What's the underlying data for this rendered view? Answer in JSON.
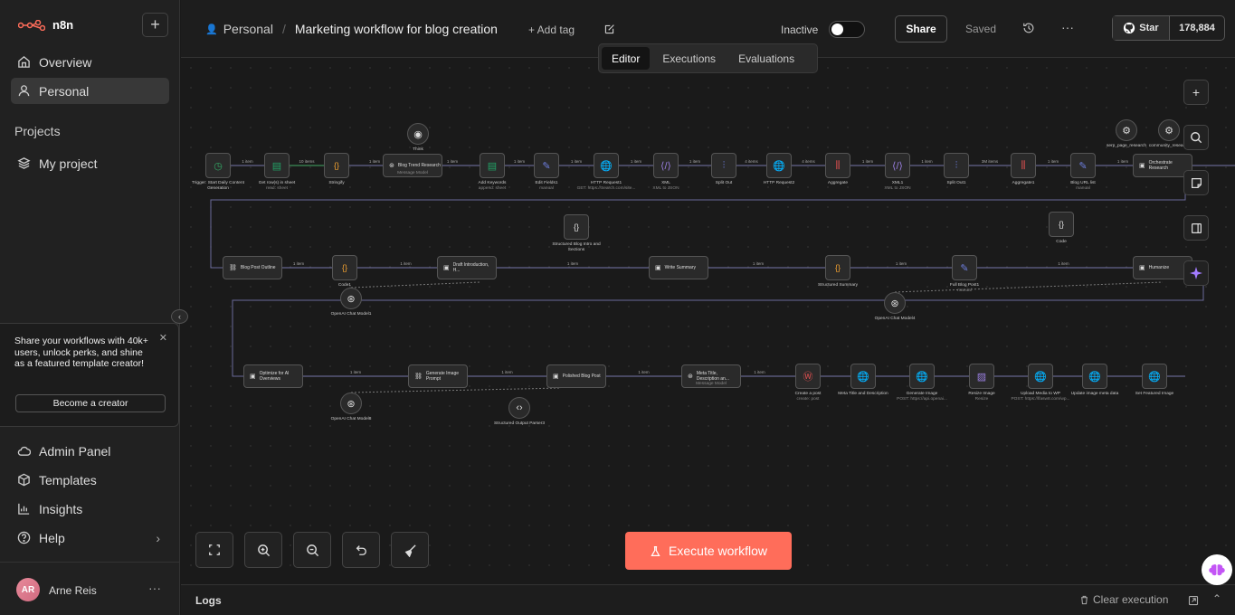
{
  "sidebar": {
    "brand": "n8n",
    "nav": [
      {
        "label": "Overview",
        "icon": "home-icon"
      },
      {
        "label": "Personal",
        "icon": "user-icon"
      }
    ],
    "projects_heading": "Projects",
    "projects": [
      {
        "label": "My project",
        "icon": "layers-icon"
      }
    ],
    "promo": {
      "text": "Share your workflows with 40k+ users, unlock perks, and shine as a featured template creator!",
      "button": "Become a creator"
    },
    "bottom_nav": [
      {
        "label": "Admin Panel",
        "icon": "cloud-icon"
      },
      {
        "label": "Templates",
        "icon": "box-icon"
      },
      {
        "label": "Insights",
        "icon": "chart-icon"
      },
      {
        "label": "Help",
        "icon": "help-icon"
      }
    ],
    "user": {
      "initials": "AR",
      "name": "Arne Reis"
    }
  },
  "header": {
    "project": "Personal",
    "workflow_name": "Marketing workflow for blog creation",
    "add_tag": "+ Add tag",
    "status": "Inactive",
    "share": "Share",
    "saved": "Saved",
    "star": "Star",
    "star_count": "178,884",
    "tabs": [
      "Editor",
      "Executions",
      "Evaluations"
    ]
  },
  "canvas": {
    "execute": "Execute workflow"
  },
  "workflow": {
    "row1": [
      {
        "label": "Trigger: Start Daily Content Generation",
        "icon": "clock",
        "color": "#33aa66"
      },
      {
        "label": "Get row(s) in sheet",
        "sub": "read: sheet",
        "icon": "sheet",
        "color": "#21a366"
      },
      {
        "label": "Stringify",
        "icon": "braces",
        "color": "#f0a030"
      },
      {
        "label": "Blog Trend Research",
        "sub": "Message Model",
        "icon": "ai",
        "wide": true
      },
      {
        "label": "Add Keywords",
        "sub": "append: sheet",
        "icon": "sheet",
        "color": "#21a366"
      },
      {
        "label": "Edit Fields1",
        "sub": "manual",
        "icon": "pen",
        "color": "#6e7fe0"
      },
      {
        "label": "HTTP Request1",
        "sub": "GET: https://Search.com/site...",
        "icon": "globe",
        "color": "#6e7fe0"
      },
      {
        "label": "XML",
        "sub": "XML to JSON",
        "icon": "xml",
        "color": "#9a7fe0"
      },
      {
        "label": "Split Out",
        "icon": "split",
        "color": "#6e7fe0"
      },
      {
        "label": "HTTP Request2",
        "icon": "globe",
        "color": "#6e7fe0"
      },
      {
        "label": "Aggregate",
        "icon": "agg",
        "color": "#e05050"
      },
      {
        "label": "XML1",
        "sub": "XML to JSON",
        "icon": "xml",
        "color": "#9a7fe0"
      },
      {
        "label": "Split Out1",
        "icon": "split",
        "color": "#6e7fe0"
      },
      {
        "label": "Aggregate1",
        "icon": "agg",
        "color": "#e05050"
      },
      {
        "label": "Blog URL list",
        "sub": "manual",
        "icon": "pen",
        "color": "#6e7fe0"
      },
      {
        "label": "Orchestrate Research",
        "icon": "robot",
        "wide": true
      }
    ],
    "row1_counts": [
      "1 item",
      "10 items",
      "1 item",
      "1 item",
      "1 item",
      "1 item",
      "1 item",
      "1 item",
      "4 items",
      "4 items",
      "1 item",
      "1 item",
      "3M items",
      "1 item",
      "1 item"
    ],
    "row1_tops": [
      {
        "label": "Think",
        "icon": "bulb"
      },
      {
        "label": "serp_page_research",
        "icon": "tool"
      },
      {
        "label": "community_research",
        "icon": "tool"
      }
    ],
    "row2": [
      {
        "label": "Blog Post Outline",
        "icon": "link",
        "wide": true
      },
      {
        "label": "Code1",
        "icon": "braces",
        "color": "#f0a030"
      },
      {
        "label": "Draft Introduction, H...",
        "icon": "robot",
        "wide": true
      },
      {
        "label": "Write Summary",
        "icon": "robot",
        "wide": true
      },
      {
        "label": "Structured Summary",
        "icon": "braces",
        "color": "#f0a030"
      },
      {
        "label": "Full Blog Post1",
        "sub": "manual",
        "icon": "pen",
        "color": "#6e7fe0"
      },
      {
        "label": "Humanize",
        "icon": "robot",
        "wide": true
      }
    ],
    "row2_counts": [
      "1 item",
      "1 item",
      "1 item",
      "1 item",
      "1 item",
      "1 item"
    ],
    "row2_extra": [
      {
        "label": "Structured Blog Intro and Sections",
        "icon": "braces"
      },
      {
        "label": "Code",
        "icon": "braces"
      },
      {
        "label": "OpenAI Chat Model1",
        "icon": "openai"
      },
      {
        "label": "OpenAI Chat Model4",
        "icon": "openai"
      }
    ],
    "row3": [
      {
        "label": "Optimize for AI Overviews",
        "icon": "robot",
        "wide": true
      },
      {
        "label": "Generate Image Prompt",
        "icon": "link",
        "wide": true
      },
      {
        "label": "Polished Blog Post",
        "icon": "robot",
        "wide": true
      },
      {
        "label": "Meta Title, Description an...",
        "sub": "Message Model",
        "icon": "ai",
        "wide": true
      },
      {
        "label": "Create a post",
        "sub": "create: post",
        "icon": "wp",
        "color": "#e05050"
      },
      {
        "label": "Meta Title and Description",
        "icon": "globe",
        "color": "#6e7fe0"
      },
      {
        "label": "Generate Image",
        "sub": "POST: https://api.openai...",
        "icon": "globe",
        "color": "#6e7fe0"
      },
      {
        "label": "Resize Image",
        "sub": "Resize",
        "icon": "image",
        "color": "#9a7fe0"
      },
      {
        "label": "Upload Media to WP",
        "sub": "POST: https://lfasw8.com/wp...",
        "icon": "globe",
        "color": "#6e7fe0"
      },
      {
        "label": "Update image meta data",
        "icon": "globe",
        "color": "#6e7fe0"
      },
      {
        "label": "Set Featured Image",
        "icon": "globe",
        "color": "#6e7fe0"
      }
    ],
    "row3_counts": [
      "1 item",
      "1 item",
      "1 item",
      "1 item"
    ],
    "row3_extra": [
      {
        "label": "OpenAI Chat Model8",
        "icon": "openai"
      },
      {
        "label": "Structured Output Parser3",
        "icon": "code"
      }
    ]
  },
  "logs": {
    "label": "Logs",
    "clear": "Clear execution"
  },
  "colors": {
    "accent": "#ff6d5a",
    "bg": "#1a1a1a"
  }
}
